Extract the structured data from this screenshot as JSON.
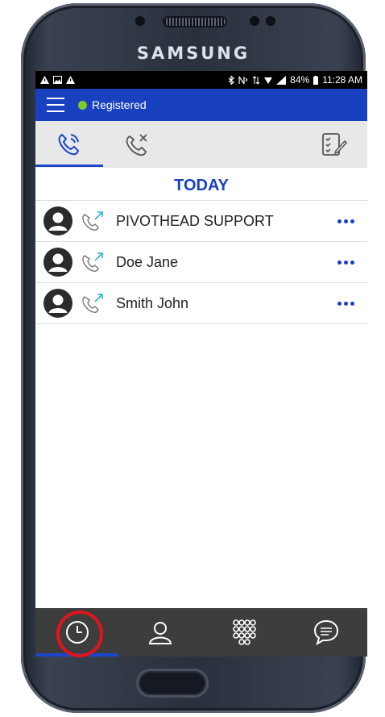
{
  "device": {
    "brand": "SAMSUNG"
  },
  "status_bar": {
    "battery": "84%",
    "time": "11:28 AM"
  },
  "app_bar": {
    "status_text": "Registered",
    "status_color": "#7ccd2c",
    "bar_color": "#1940bf"
  },
  "tabs": [
    {
      "icon": "recent-calls-icon",
      "active": true
    },
    {
      "icon": "missed-calls-icon",
      "active": false
    },
    {
      "icon": "edit-list-icon",
      "active": false
    }
  ],
  "section_header": "TODAY",
  "call_log": [
    {
      "name": "PIVOTHEAD SUPPORT",
      "type": "outgoing"
    },
    {
      "name": "Doe Jane",
      "type": "outgoing"
    },
    {
      "name": "Smith John",
      "type": "outgoing"
    }
  ],
  "bottom_nav": [
    {
      "icon": "history-clock-icon",
      "active": true,
      "highlighted": true
    },
    {
      "icon": "contacts-icon",
      "active": false
    },
    {
      "icon": "dialpad-icon",
      "active": false
    },
    {
      "icon": "chat-icon",
      "active": false
    }
  ],
  "colors": {
    "accent": "#1a41c0",
    "highlight_ring": "#e2141a",
    "nav_bg": "#3d3d3d"
  }
}
